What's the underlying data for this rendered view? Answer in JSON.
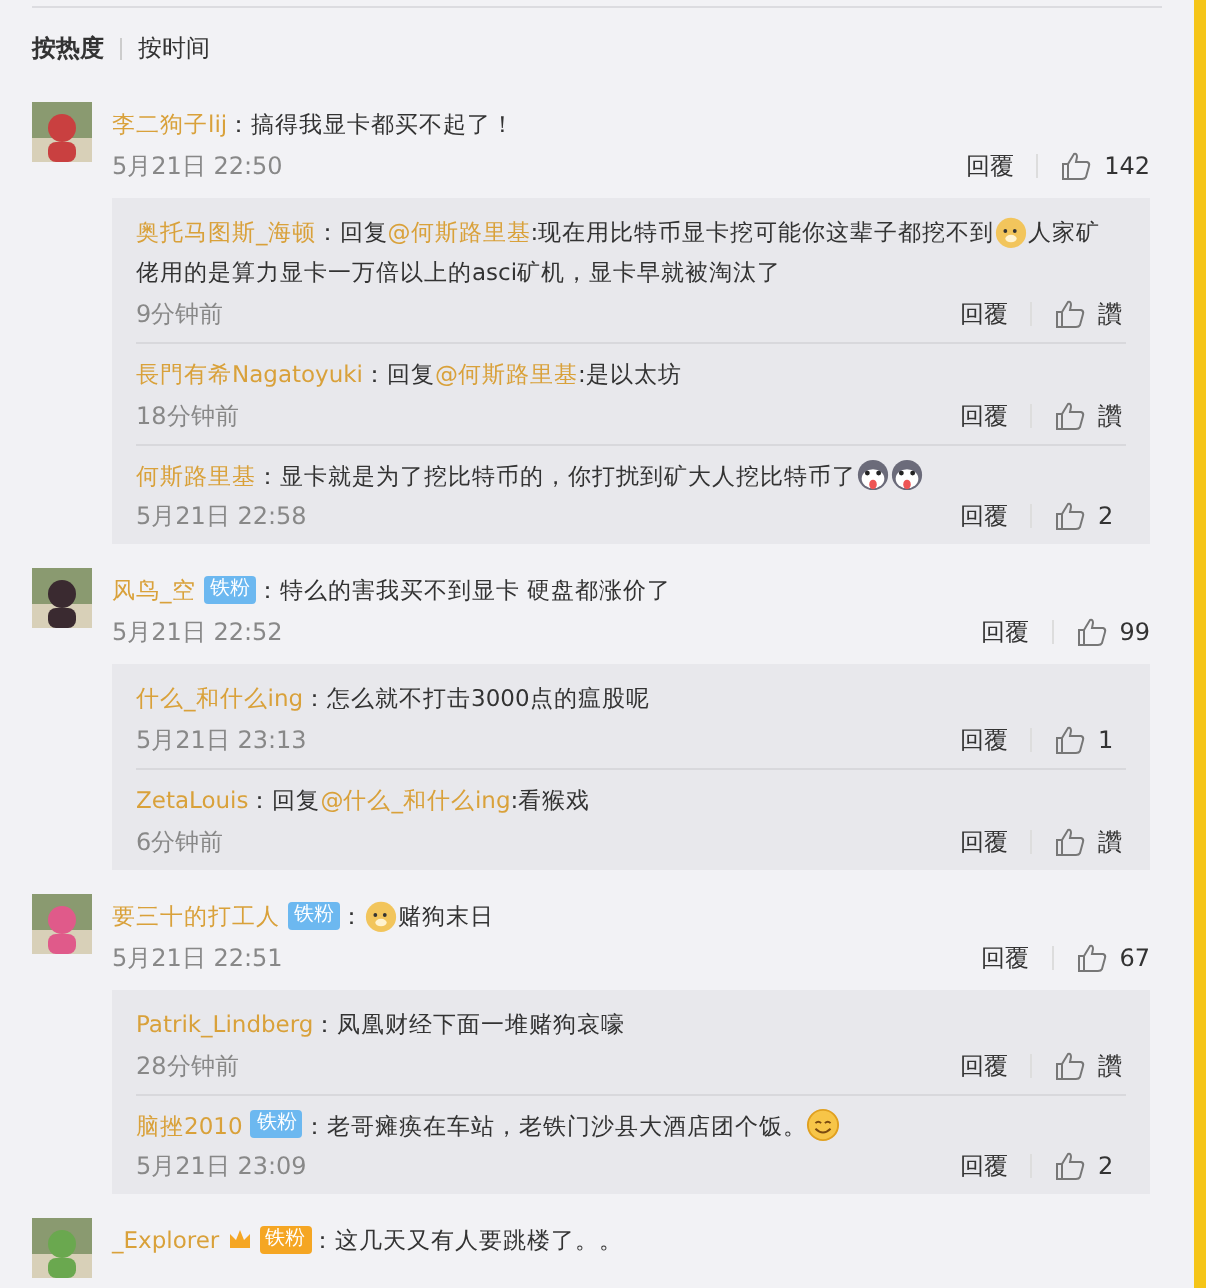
{
  "sort_tabs": [
    {
      "label": "按热度",
      "selected": true
    },
    {
      "label": "按时间",
      "selected": false
    }
  ],
  "comments": [
    {
      "user": "李二狗子lij",
      "parts": [
        {
          "kind": "text",
          "text": "：搞得我显卡都买不起了！"
        }
      ],
      "time": "5月21日 22:50",
      "reply_label": "回覆",
      "likes": "142",
      "replies": [
        {
          "user": "奥托马图斯_海顿",
          "parts": [
            {
              "kind": "text",
              "text": "：回复"
            },
            {
              "kind": "mention",
              "text": "@何斯路里基"
            },
            {
              "kind": "text",
              "text": ":现在用比特币显卡挖可能你这辈子都挖不到"
            },
            {
              "kind": "doge"
            },
            {
              "kind": "text",
              "text": "人家矿"
            },
            {
              "kind": "line",
              "text": "佬用的是算力显卡一万倍以上的asci矿机，显卡早就被淘汰了"
            }
          ],
          "time": "9分钟前",
          "reply_label": "回覆",
          "likes": "讚"
        },
        {
          "user": "長門有希Nagatoyuki",
          "parts": [
            {
              "kind": "text",
              "text": "：回复"
            },
            {
              "kind": "mention",
              "text": "@何斯路里基"
            },
            {
              "kind": "text",
              "text": ":是以太坊"
            }
          ],
          "time": "18分钟前",
          "reply_label": "回覆",
          "likes": "讚"
        },
        {
          "user": "何斯路里基",
          "parts": [
            {
              "kind": "text",
              "text": "：显卡就是为了挖比特币的，你打扰到矿大人挖比特币了"
            },
            {
              "kind": "husky"
            },
            {
              "kind": "husky"
            }
          ],
          "time": "5月21日 22:58",
          "reply_label": "回覆",
          "likes": "2"
        }
      ]
    },
    {
      "user": "风鸟_空",
      "badge": {
        "label": "铁粉",
        "kind": "blue"
      },
      "parts": [
        {
          "kind": "text",
          "text": "：特么的害我买不到显卡 硬盘都涨价了"
        }
      ],
      "time": "5月21日 22:52",
      "reply_label": "回覆",
      "likes": "99",
      "replies": [
        {
          "user": "什么_和什么ing",
          "parts": [
            {
              "kind": "text",
              "text": "：怎么就不打击3000点的瘟股呢"
            }
          ],
          "time": "5月21日 23:13",
          "reply_label": "回覆",
          "likes": "1"
        },
        {
          "user": "ZetaLouis",
          "parts": [
            {
              "kind": "text",
              "text": "：回复"
            },
            {
              "kind": "mention",
              "text": "@什么_和什么ing"
            },
            {
              "kind": "text",
              "text": ":看猴戏"
            }
          ],
          "time": "6分钟前",
          "reply_label": "回覆",
          "likes": "讚"
        }
      ]
    },
    {
      "user": "要三十的打工人",
      "badge": {
        "label": "铁粉",
        "kind": "blue"
      },
      "parts": [
        {
          "kind": "text",
          "text": "："
        },
        {
          "kind": "doge"
        },
        {
          "kind": "text",
          "text": "赌狗末日"
        }
      ],
      "time": "5月21日 22:51",
      "reply_label": "回覆",
      "likes": "67",
      "replies": [
        {
          "user": "Patrik_Lindberg",
          "parts": [
            {
              "kind": "text",
              "text": "：凤凰财经下面一堆赌狗哀嚎"
            }
          ],
          "time": "28分钟前",
          "reply_label": "回覆",
          "likes": "讚"
        },
        {
          "user": "脑挫2010",
          "badge": {
            "label": "铁粉",
            "kind": "blue"
          },
          "parts": [
            {
              "kind": "text",
              "text": "：老哥瘫痪在车站，老铁门沙县大酒店团个饭。"
            },
            {
              "kind": "smile"
            }
          ],
          "time": "5月21日 23:09",
          "reply_label": "回覆",
          "likes": "2"
        }
      ]
    },
    {
      "user": "_Explorer",
      "badge": {
        "label": "铁粉",
        "kind": "gold"
      },
      "parts": [
        {
          "kind": "text",
          "text": "：这几天又有人要跳楼了。。"
        }
      ]
    }
  ]
}
